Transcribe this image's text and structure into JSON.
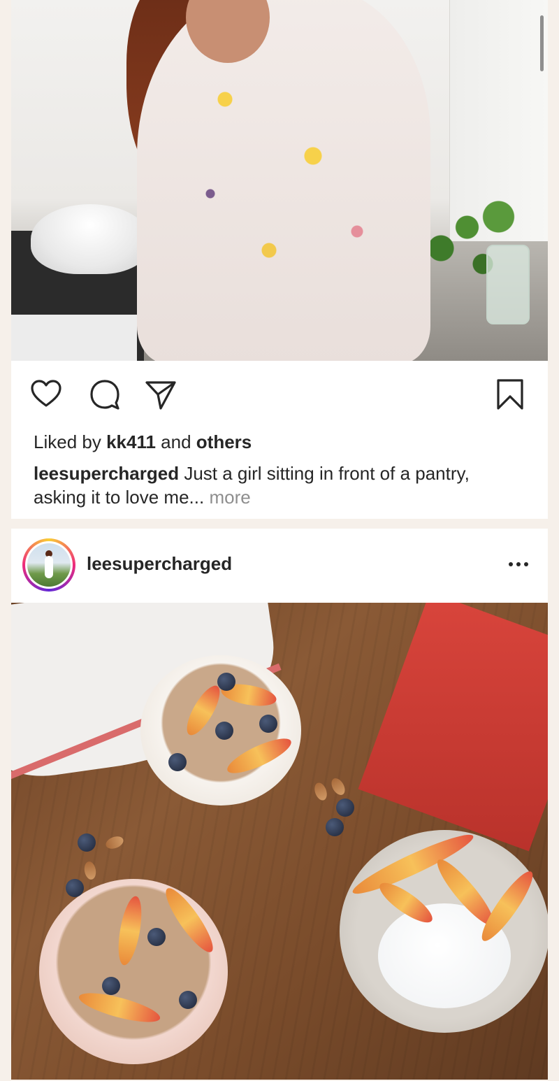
{
  "post1": {
    "likes": {
      "prefix": "Liked by ",
      "user": "kk411",
      "middle": " and ",
      "others": "others"
    },
    "caption": {
      "username": "leesupercharged",
      "text": " Just a girl sitting in front of a pantry, asking it to love me...",
      "more": " more"
    }
  },
  "post2": {
    "username": "leesupercharged"
  },
  "icons": {
    "like": "heart-icon",
    "comment": "comment-icon",
    "share": "paper-plane-icon",
    "save": "bookmark-icon",
    "options": "ellipsis-icon"
  },
  "colors": {
    "text": "#262626",
    "muted": "#8e8e8e",
    "feed_background": "#f6f0ea",
    "card_background": "#ffffff"
  }
}
